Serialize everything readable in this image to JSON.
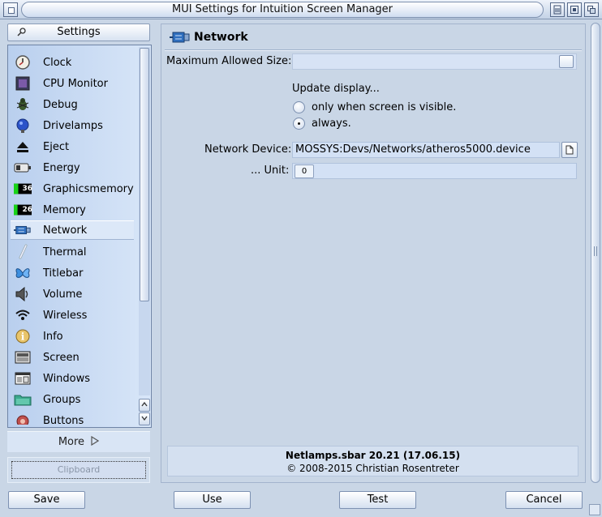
{
  "window": {
    "title": "MUI Settings for Intuition Screen Manager"
  },
  "sidebar": {
    "settings_label": "Settings",
    "items": [
      {
        "label": "Clock",
        "icon": "clock-icon"
      },
      {
        "label": "CPU Monitor",
        "icon": "cpu-monitor-icon"
      },
      {
        "label": "Debug",
        "icon": "bug-icon"
      },
      {
        "label": "Drivelamps",
        "icon": "drivelamp-icon"
      },
      {
        "label": "Eject",
        "icon": "eject-icon"
      },
      {
        "label": "Energy",
        "icon": "battery-icon"
      },
      {
        "label": "Graphicsmemory",
        "icon": "graphics-memory-icon",
        "badge": "36"
      },
      {
        "label": "Memory",
        "icon": "memory-icon",
        "badge": "26"
      },
      {
        "label": "Network",
        "icon": "network-icon",
        "selected": true
      },
      {
        "label": "Thermal",
        "icon": "thermometer-icon"
      },
      {
        "label": "Titlebar",
        "icon": "butterfly-icon"
      },
      {
        "label": "Volume",
        "icon": "speaker-icon"
      },
      {
        "label": "Wireless",
        "icon": "wireless-icon"
      },
      {
        "label": "Info",
        "icon": "info-icon"
      },
      {
        "label": "Screen",
        "icon": "screen-icon"
      },
      {
        "label": "Windows",
        "icon": "windows-icon"
      },
      {
        "label": "Groups",
        "icon": "folder-icon"
      },
      {
        "label": "Buttons",
        "icon": "buttons-icon"
      }
    ],
    "more_label": "More",
    "clipboard_label": "Clipboard"
  },
  "panel": {
    "title": "Network",
    "max_size_label": "Maximum Allowed Size:",
    "update_label": "Update display...",
    "radio_options": [
      {
        "label": "only when screen is visible.",
        "selected": false
      },
      {
        "label": "always.",
        "selected": true
      }
    ],
    "device_label": "Network Device:",
    "device_value": "MOSSYS:Devs/Networks/atheros5000.device",
    "unit_label": "... Unit:",
    "unit_value": "0",
    "about_line1": "Netlamps.sbar 20.21 (17.06.15)",
    "about_line2": "© 2008-2015 Christian Rosentreter"
  },
  "buttons": {
    "save": "Save",
    "use": "Use",
    "test": "Test",
    "cancel": "Cancel"
  },
  "colors": {
    "background": "#c9d6e6",
    "list_background": "#c6d9f2",
    "selection": "#dce8f8",
    "field": "#d3e1f5"
  }
}
